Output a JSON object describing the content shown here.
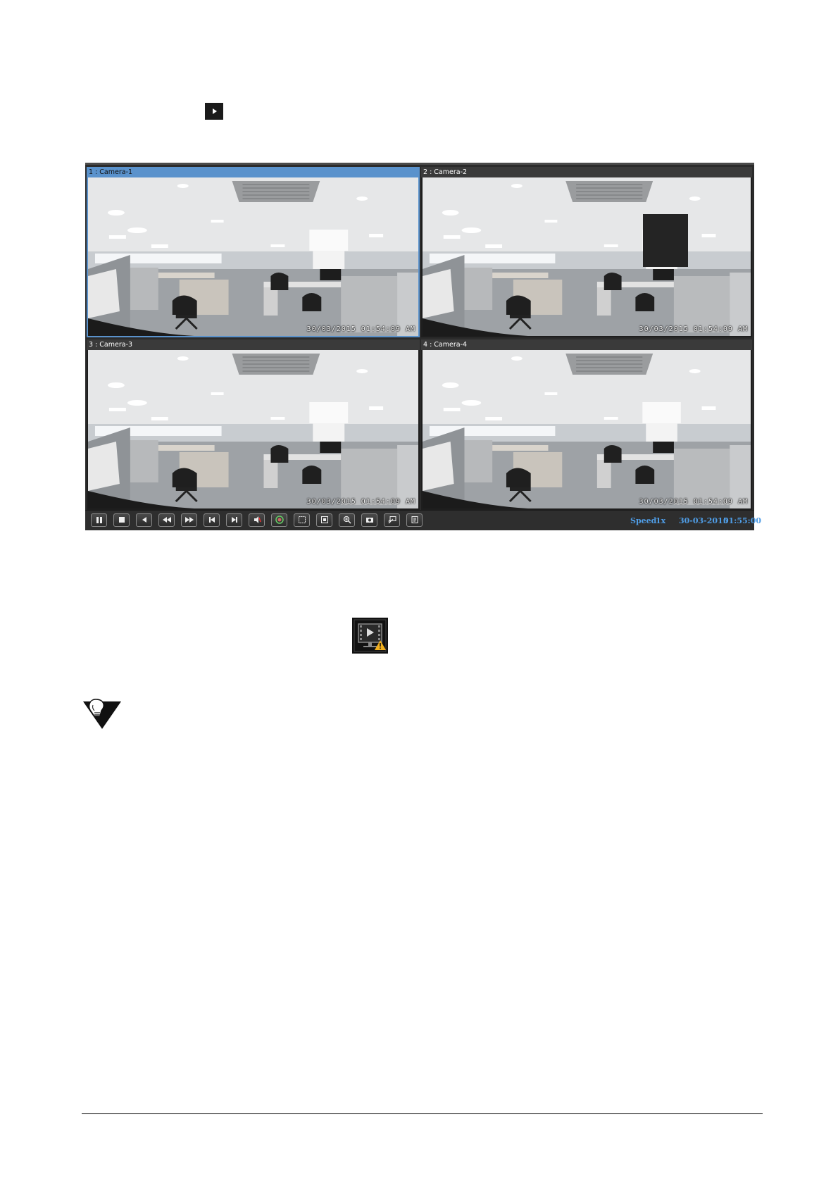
{
  "player": {
    "tiles": [
      {
        "title": "1 : Camera-1",
        "osd": "30/03/2015 01:54:09 AM",
        "active": true
      },
      {
        "title": "2 : Camera-2",
        "osd": "30/03/2015 01:54:09 AM",
        "active": false
      },
      {
        "title": "3 : Camera-3",
        "osd": "30/03/2015 01:54:09 AM",
        "active": false
      },
      {
        "title": "4 : Camera-4",
        "osd": "30/03/2015 01:54:09 AM",
        "active": false
      }
    ],
    "controls": [
      "pause-icon",
      "stop-icon",
      "reverse-play-icon",
      "rewind-icon",
      "fast-forward-icon",
      "previous-frame-icon",
      "next-frame-icon",
      "mute-icon",
      "color-adjust-icon",
      "fit-screen-icon",
      "full-screen-icon",
      "zoom-in-icon",
      "snapshot-icon",
      "clip-icon",
      "notes-icon"
    ],
    "status": {
      "speed_label": "Speed",
      "speed_value": "1x",
      "date": "30-03-2015",
      "time": "01:55:00"
    }
  },
  "icons": {
    "top": "play-icon",
    "alert": "video-alert-icon",
    "note": "note-icon"
  },
  "colors": {
    "accent": "#4f9de6",
    "active_tile": "#5a92cc",
    "warning": "#f2b01e"
  }
}
